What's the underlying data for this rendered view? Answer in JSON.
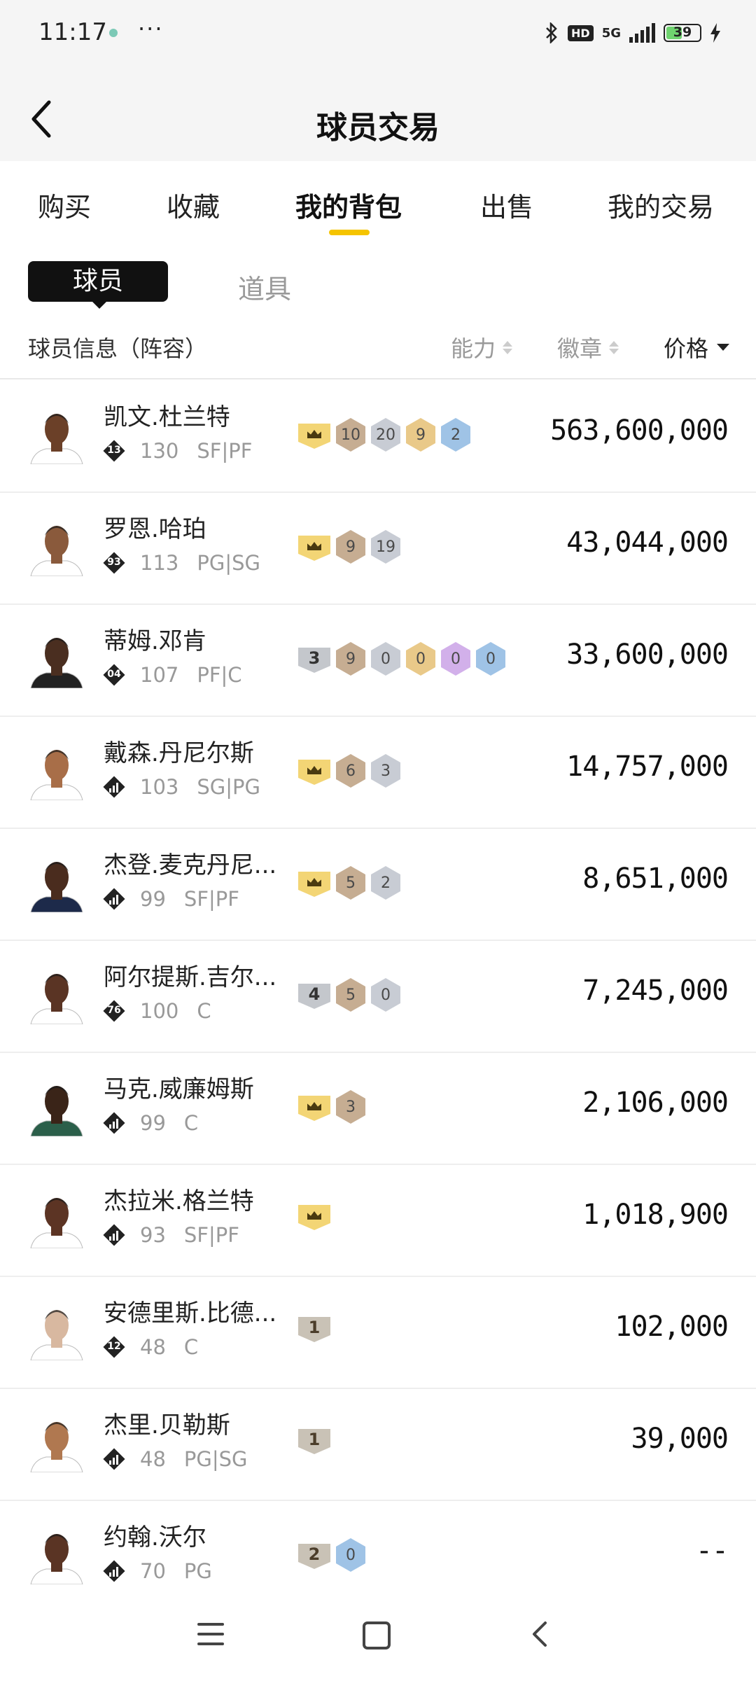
{
  "status_bar": {
    "time": "11:17",
    "dots": "···",
    "hd": "HD",
    "network": "5G",
    "battery": "39"
  },
  "header": {
    "title": "球员交易"
  },
  "tabs": [
    {
      "label": "购买"
    },
    {
      "label": "收藏"
    },
    {
      "label": "我的背包",
      "active": true
    },
    {
      "label": "出售"
    },
    {
      "label": "我的交易"
    }
  ],
  "subtabs": {
    "active": "球员",
    "inactive": "道具"
  },
  "columns": {
    "info": "球员信息（阵容）",
    "ability": "能力",
    "badge": "徽章",
    "price": "价格"
  },
  "colors": {
    "accent": "#f5c400",
    "rank_gold": "#f3d575"
  },
  "players": [
    {
      "name": "凯文.杜兰特",
      "jersey": "13",
      "rating": "130",
      "position": "SF|PF",
      "rank": "crown",
      "badges": [
        {
          "value": "10",
          "tier": "bronze"
        },
        {
          "value": "20",
          "tier": "silver"
        },
        {
          "value": "9",
          "tier": "gold"
        },
        {
          "value": "2",
          "tier": "blue"
        }
      ],
      "price": "563,600,000",
      "skin": "#6b4028",
      "jersey_color": "#ffffff"
    },
    {
      "name": "罗恩.哈珀",
      "jersey": "93",
      "rating": "113",
      "position": "PG|SG",
      "rank": "crown",
      "badges": [
        {
          "value": "9",
          "tier": "bronze"
        },
        {
          "value": "19",
          "tier": "silver"
        }
      ],
      "price": "43,044,000",
      "skin": "#8a5a3c",
      "jersey_color": "#ffffff"
    },
    {
      "name": "蒂姆.邓肯",
      "jersey": "04",
      "rating": "107",
      "position": "PF|C",
      "rank": "3",
      "badges": [
        {
          "value": "9",
          "tier": "bronze"
        },
        {
          "value": "0",
          "tier": "silver"
        },
        {
          "value": "0",
          "tier": "gold"
        },
        {
          "value": "0",
          "tier": "purple"
        },
        {
          "value": "0",
          "tier": "blue"
        }
      ],
      "price": "33,600,000",
      "skin": "#4a2e20",
      "jersey_color": "#222222"
    },
    {
      "name": "戴森.丹尼尔斯",
      "jersey": "",
      "rating": "103",
      "position": "SG|PG",
      "rank": "crown",
      "badges": [
        {
          "value": "6",
          "tier": "bronze"
        },
        {
          "value": "3",
          "tier": "silver"
        }
      ],
      "price": "14,757,000",
      "skin": "#a86e48",
      "jersey_color": "#ffffff"
    },
    {
      "name": "杰登.麦克丹尼...",
      "jersey": "",
      "rating": "99",
      "position": "SF|PF",
      "rank": "crown",
      "badges": [
        {
          "value": "5",
          "tier": "bronze"
        },
        {
          "value": "2",
          "tier": "silver"
        }
      ],
      "price": "8,651,000",
      "skin": "#4a2c1e",
      "jersey_color": "#1d2a4a"
    },
    {
      "name": "阿尔提斯.吉尔...",
      "jersey": "76",
      "rating": "100",
      "position": "C",
      "rank": "4",
      "badges": [
        {
          "value": "5",
          "tier": "bronze"
        },
        {
          "value": "0",
          "tier": "silver"
        }
      ],
      "price": "7,245,000",
      "skin": "#5a3424",
      "jersey_color": "#ffffff"
    },
    {
      "name": "马克.威廉姆斯",
      "jersey": "",
      "rating": "99",
      "position": "C",
      "rank": "crown",
      "badges": [
        {
          "value": "3",
          "tier": "bronze"
        }
      ],
      "price": "2,106,000",
      "skin": "#3a2418",
      "jersey_color": "#2b5f4a"
    },
    {
      "name": "杰拉米.格兰特",
      "jersey": "",
      "rating": "93",
      "position": "SF|PF",
      "rank": "crown",
      "badges": [],
      "price": "1,018,900",
      "skin": "#5c3424",
      "jersey_color": "#ffffff"
    },
    {
      "name": "安德里斯.比德...",
      "jersey": "12",
      "rating": "48",
      "position": "C",
      "rank": "1",
      "badges": [],
      "price": "102,000",
      "skin": "#d8b8a0",
      "jersey_color": "#ffffff"
    },
    {
      "name": "杰里.贝勒斯",
      "jersey": "",
      "rating": "48",
      "position": "PG|SG",
      "rank": "1",
      "badges": [],
      "price": "39,000",
      "skin": "#b07850",
      "jersey_color": "#ffffff"
    },
    {
      "name": "约翰.沃尔",
      "jersey": "",
      "rating": "70",
      "position": "PG",
      "rank": "2",
      "badges": [
        {
          "value": "0",
          "tier": "blue"
        }
      ],
      "price": "--",
      "skin": "#5a3424",
      "jersey_color": "#ffffff"
    }
  ]
}
